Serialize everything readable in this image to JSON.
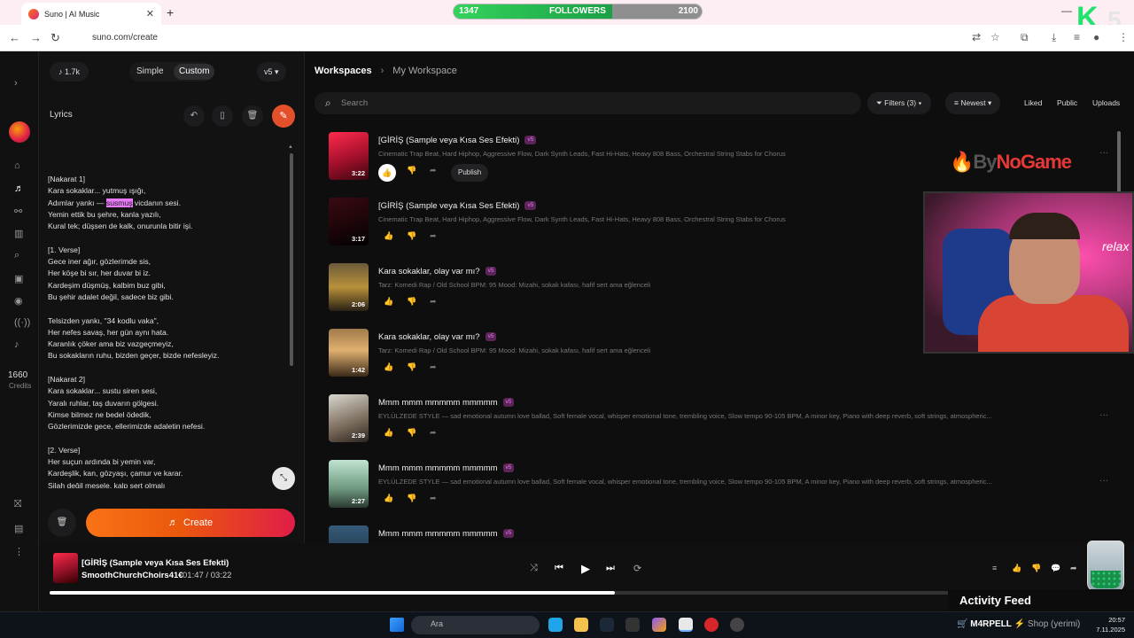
{
  "browser": {
    "tab_title": "Suno | AI Music",
    "url": "suno.com/create",
    "followers": {
      "label": "FOLLOWERS",
      "current": "1347",
      "goal": "2100",
      "progress": 0.64
    }
  },
  "sidebar": {
    "credits": "1660",
    "credits_label": "Credits"
  },
  "create_panel": {
    "song_count": "1.7k",
    "mode_simple": "Simple",
    "mode_custom": "Custom",
    "version": "v5",
    "lyrics_label": "Lyrics",
    "create_label": "Create",
    "lyrics": [
      {
        "lines": [
          "[Nakarat 1]",
          "Kara sokaklar... yutmuş ışığı,",
          "Adımlar yankı — ",
          "Yemin ettik bu şehre, kanla yazılı,",
          "Kural tek; düşsen de kalk, onurunla bitir işi."
        ]
      },
      {
        "lines": [
          "[1. Verse]",
          "Gece iner ağır, gözlerimde sis,",
          "Her köşe bi sır, her duvar bi iz.",
          "Kardeşim düşmüş, kalbim buz gibi,",
          "Bu şehir adalet değil, sadece biz gibi."
        ]
      },
      {
        "lines": [
          "Telsizden yankı, \"34 kodlu vaka\",",
          "Her nefes savaş, her gün aynı hata.",
          "Karanlık çöker ama biz vazgeçmeyiz,",
          "Bu sokakların ruhu, bizden geçer, bizde nefesleyiz."
        ]
      },
      {
        "lines": [
          "[Nakarat 2]",
          "Kara sokaklar... sustu siren sesi,",
          "Yaralı ruhlar, taş duvarın gölgesi.",
          "Kimse bilmez ne bedel ödedik,",
          "Gözlerimizde gece, ellerimizde adaletin nefesi."
        ]
      },
      {
        "lines": [
          "[2. Verse]",
          "Her suçun ardında bi yemin var,",
          "Kardeşlik, kan, gözyaşı, çamur ve karar.",
          "Silah değil mesele, kalp sert olmalı"
        ]
      }
    ],
    "lyric_highlight": "susmuş",
    "lyric_highlight_after": " vicdanın sesi."
  },
  "main": {
    "breadcrumb_root": "Workspaces",
    "breadcrumb_current": "My Workspace",
    "search_placeholder": "Search",
    "filters_label": "Filters (3)",
    "sort_label": "Newest",
    "liked_label": "Liked",
    "public_label": "Public",
    "uploads_label": "Uploads",
    "publish_label": "Publish",
    "songs": [
      {
        "title": "[GİRİŞ (Sample veya Kısa Ses Efekti)",
        "version": "v5",
        "duration": "3:22",
        "desc": "Cinematic Trap Beat, Hard Hiphop, Aggressive Flow, Dark Synth Leads, Fast Hi-Hats, Heavy 808 Bass, Orchestral String Stabs for Chorus"
      },
      {
        "title": "[GİRİŞ (Sample veya Kısa Ses Efekti)",
        "version": "v5",
        "duration": "3:17",
        "desc": "Cinematic Trap Beat, Hard Hiphop, Aggressive Flow, Dark Synth Leads, Fast Hi-Hats, Heavy 808 Bass, Orchestral String Stabs for Chorus"
      },
      {
        "title": "Kara sokaklar, olay var mı?",
        "version": "v5",
        "duration": "2:06",
        "desc": "Tarz: Komedi Rap / Old School BPM: 95 Mood: Mizahi, sokak kafası, hafif sert ama eğlenceli"
      },
      {
        "title": "Kara sokaklar, olay var mı?",
        "version": "v5",
        "duration": "1:42",
        "desc": "Tarz: Komedi Rap / Old School BPM: 95 Mood: Mizahi, sokak kafası, hafif sert ama eğlenceli"
      },
      {
        "title": "Mmm mmm mmmmm mmmmm",
        "version": "v5",
        "duration": "2:39",
        "desc": "EYLÜLZEDE STYLE — sad emotional autumn love ballad, Soft female vocal, whisper emotional tone, trembling voice, Slow tempo 90-105 BPM, A minor key, Piano with deep reverb, soft strings, atmospheric..."
      },
      {
        "title": "Mmm mmm mmmmm mmmmm",
        "version": "v5",
        "duration": "2:27",
        "desc": "EYLÜLZEDE STYLE — sad emotional autumn love ballad, Soft female vocal, whisper emotional tone, trembling voice, Slow tempo 90-105 BPM, A minor key, Piano with deep reverb, soft strings, atmospheric..."
      },
      {
        "title": "Mmm mmm mmmmm mmmmm",
        "version": "v5",
        "duration": "",
        "desc": "EYLÜLZEDE STYLE — sad emotional autumn love ballad, Soft female vocal, whisper emotional tone, trembling voice, Slow tempo 90-105 BPM, A minor key, Piano with deep reverb, soft strings, atmospheric..."
      }
    ]
  },
  "player": {
    "title": "[GİRİŞ (Sample veya Kısa Ses Efekti)",
    "artist": "SmoothChurchChoirs41€",
    "time": "01:47  /  03:22",
    "progress": 0.55
  },
  "overlay": {
    "watermark_a": "By",
    "watermark_b": "NoGame",
    "activity_feed": "Activity Feed",
    "neon_text": "relax",
    "badge_k": "K",
    "badge_num": "5"
  },
  "taskbar": {
    "search_placeholder": "Ara",
    "shop_user": "M4RPELL",
    "shop_text": " ⚡ Shop ",
    "shop_paren": "(yerimi)",
    "time": "20:57",
    "date": "7.11.2025"
  },
  "colors": {
    "accent": "#e5502c",
    "version_badge": "#e879f9",
    "followers_fill": "#2fc457"
  }
}
